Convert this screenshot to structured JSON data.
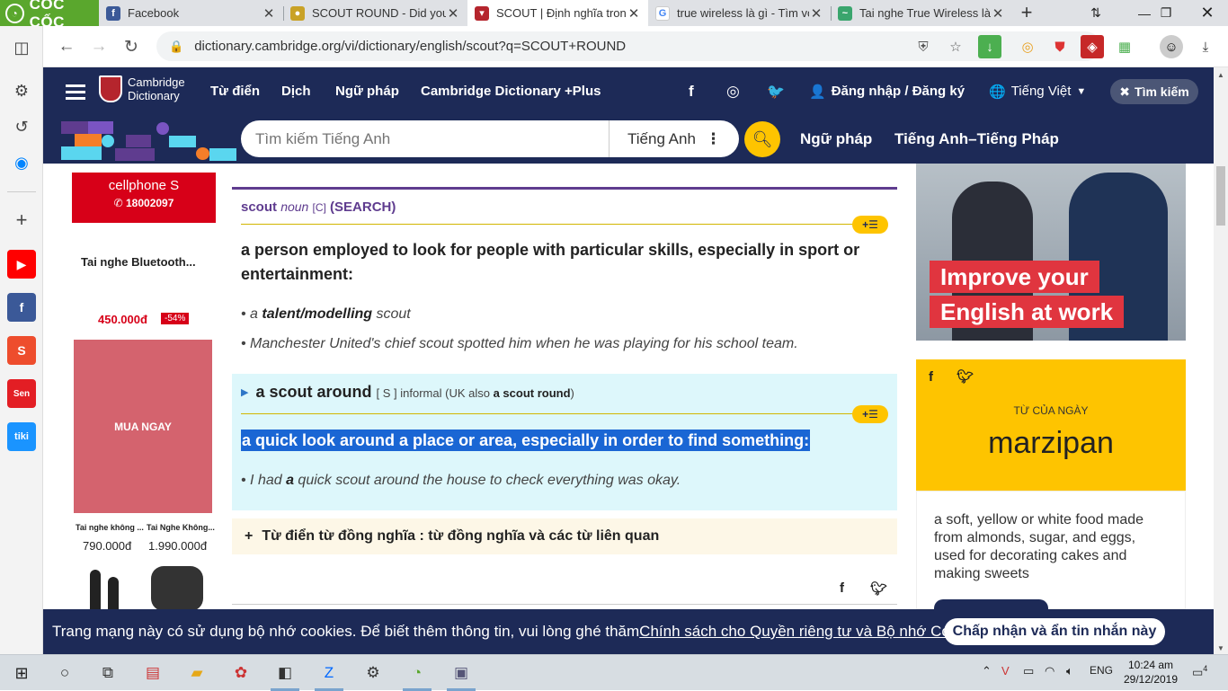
{
  "browser": {
    "brand": "CỐC CỐC",
    "tabs": [
      {
        "title": "Facebook",
        "favicon_color": "#3b5998",
        "active": false
      },
      {
        "title": "SCOUT ROUND - Did you spell i",
        "favicon_color": "#7a7a7a",
        "active": false
      },
      {
        "title": "SCOUT | Định nghĩa trong T",
        "favicon_color": "#b5252d",
        "active": true
      },
      {
        "title": "true wireless là gì - Tìm với G",
        "favicon_color": "#4285f4",
        "active": false
      },
      {
        "title": "Tai nghe True Wireless là gì?",
        "favicon_color": "#3aa56d",
        "active": false
      }
    ],
    "new_tab_label": "+",
    "url": "dictionary.cambridge.org/vi/dictionary/english/scout?q=SCOUT+ROUND"
  },
  "header": {
    "logo_line1": "Cambridge",
    "logo_line2": "Dictionary",
    "nav": [
      "Từ điển",
      "Dịch",
      "Ngữ pháp",
      "Cambridge Dictionary +Plus"
    ],
    "login": "Đăng nhập / Đăng ký",
    "language": "Tiếng Việt",
    "search_button": "Tìm kiếm",
    "search_placeholder": "Tìm kiếm Tiếng Anh",
    "search_lang": "Tiếng Anh",
    "subnav": [
      "Ngữ pháp",
      "Tiếng Anh–Tiếng Pháp"
    ]
  },
  "left_ad": {
    "brand": "cellphone S",
    "phone": "18002097",
    "product": "Tai nghe Bluetooth...",
    "price": "450.000đ",
    "discount": "-54%",
    "cta": "MUA NGAY",
    "item1_name": "Tai nghe không ...",
    "item2_name": "Tai Nghe Không...",
    "item1_price": "790.000đ",
    "item2_price": "1.990.000đ"
  },
  "entry": {
    "headword": "scout",
    "pos": "noun",
    "grammar": "[C]",
    "guideword": "(SEARCH)",
    "add_label": "+☰",
    "definition": "a person employed to look for people with particular skills, especially in sport or entertainment:",
    "examples": [
      {
        "pre": "a ",
        "bold": "talent/modelling",
        "post": " scout"
      },
      {
        "pre": "Manchester United's chief scout spotted him when he was playing for his school team.",
        "bold": "",
        "post": ""
      }
    ],
    "idiom": {
      "phrase": "a scout around",
      "grammar": "[ S ]",
      "register": "informal",
      "also_pre": "(UK also ",
      "also_bold": "a scout round",
      "also_post": ")",
      "definition": "a quick look around a place or area, especially in order to find something:",
      "example_pre": "I had ",
      "example_bold": "a",
      "example_post": " quick scout around the house to check everything was okay."
    },
    "thesaurus": "Từ điển từ đồng nghĩa : từ đồng nghĩa và các từ liên quan"
  },
  "right_ad": {
    "line1": "Improve your",
    "line2": "English at work"
  },
  "word_of_day": {
    "label": "TỪ CỦA NGÀY",
    "word": "marzipan",
    "definition": "a soft, yellow or white food made from almonds, sugar, and eggs, used for decorating cakes and making sweets"
  },
  "cookie": {
    "text": "Trang mạng này có sử dụng bộ nhớ cookies. Để biết thêm thông tin, vui lòng ghé thăm ",
    "link": "Chính sách cho Quyền riêng tư và Bộ nhớ Cookies",
    "end": ".",
    "button": "Chấp nhận và ẩn tin nhắn này"
  },
  "taskbar": {
    "lang": "ENG",
    "time": "10:24 am",
    "date": "29/12/2019",
    "notifications": "4"
  }
}
